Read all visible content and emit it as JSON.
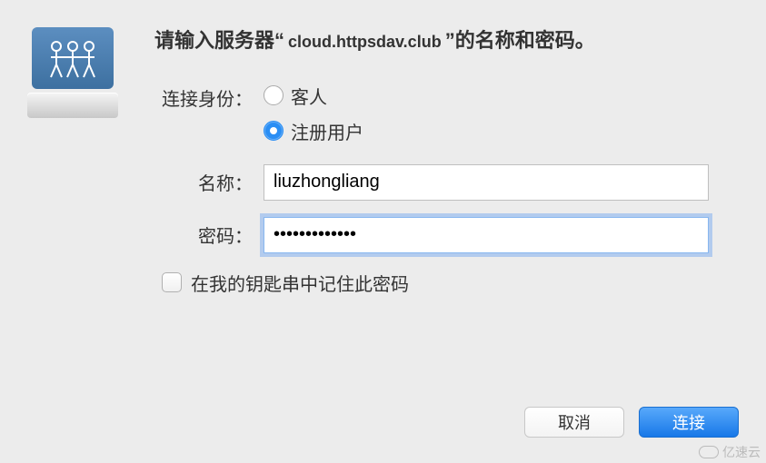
{
  "header": {
    "prefix": "请输入服务器“",
    "host": "cloud.httpsdav.club",
    "suffix": "”的名称和密码。"
  },
  "identity": {
    "label": "连接身份：",
    "options": [
      {
        "label": "客人",
        "selected": false
      },
      {
        "label": "注册用户",
        "selected": true
      }
    ]
  },
  "fields": {
    "name": {
      "label": "名称：",
      "value": "liuzhongliang"
    },
    "password": {
      "label": "密码：",
      "value": "•••••••••••••"
    }
  },
  "remember": {
    "label": "在我的钥匙串中记住此密码",
    "checked": false
  },
  "buttons": {
    "cancel": "取消",
    "connect": "连接"
  },
  "watermark": "亿速云"
}
